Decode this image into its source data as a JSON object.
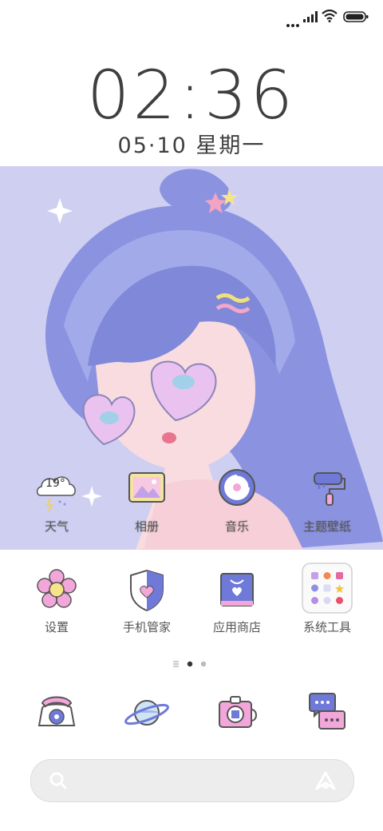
{
  "status_bar": {
    "signal_icon": "signal-bars-icon",
    "wifi_icon": "wifi-icon",
    "battery_icon": "battery-icon"
  },
  "clock": {
    "time": "02:36",
    "date": "05·10 星期一"
  },
  "weather_widget": {
    "temperature": "19°"
  },
  "wallpaper_apps": [
    {
      "label": "天气",
      "icon": "weather-cloud-icon"
    },
    {
      "label": "相册",
      "icon": "gallery-icon"
    },
    {
      "label": "音乐",
      "icon": "music-disc-icon"
    },
    {
      "label": "主题壁纸",
      "icon": "paint-roller-icon"
    }
  ],
  "apps": [
    {
      "label": "设置",
      "icon": "flower-settings-icon"
    },
    {
      "label": "手机管家",
      "icon": "shield-heart-icon"
    },
    {
      "label": "应用商店",
      "icon": "store-bag-icon"
    },
    {
      "label": "系统工具",
      "icon": "tools-folder-icon"
    }
  ],
  "dock": [
    {
      "icon": "phone-icon"
    },
    {
      "icon": "browser-planet-icon"
    },
    {
      "icon": "camera-icon"
    },
    {
      "icon": "messages-icon"
    }
  ],
  "search_bar": {
    "search_icon": "search-icon",
    "assistant_icon": "assistant-icon"
  },
  "colors": {
    "wallpaper_bg": "#cfcff2",
    "accent_purple": "#6f79d8",
    "accent_pink": "#f2a6d9",
    "clock_text": "#3f3f3f"
  }
}
